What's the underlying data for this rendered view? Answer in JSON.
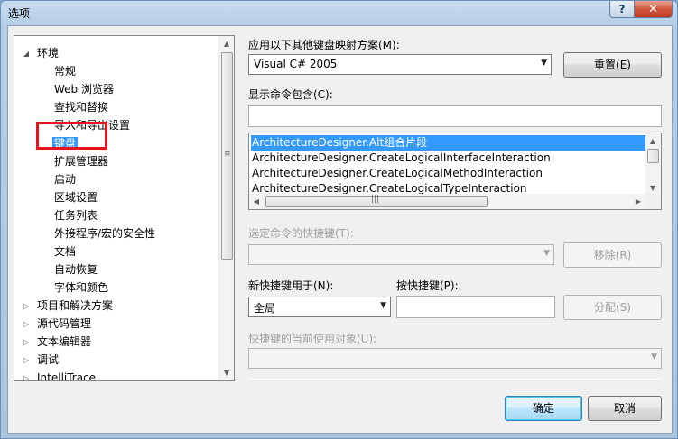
{
  "window": {
    "title": "选项",
    "help_glyph": "?",
    "close_glyph": "✕"
  },
  "tree": {
    "items": [
      {
        "label": "环境",
        "level": 0,
        "expanded": true
      },
      {
        "label": "常规",
        "level": 1
      },
      {
        "label": "Web 浏览器",
        "level": 1
      },
      {
        "label": "查找和替换",
        "level": 1
      },
      {
        "label": "导入和导出设置",
        "level": 1
      },
      {
        "label": "键盘",
        "level": 1,
        "selected": true
      },
      {
        "label": "扩展管理器",
        "level": 1
      },
      {
        "label": "启动",
        "level": 1
      },
      {
        "label": "区域设置",
        "level": 1
      },
      {
        "label": "任务列表",
        "level": 1
      },
      {
        "label": "外接程序/宏的安全性",
        "level": 1
      },
      {
        "label": "文档",
        "level": 1
      },
      {
        "label": "自动恢复",
        "level": 1
      },
      {
        "label": "字体和颜色",
        "level": 1
      },
      {
        "label": "项目和解决方案",
        "level": 0,
        "expanded": false
      },
      {
        "label": "源代码管理",
        "level": 0,
        "expanded": false
      },
      {
        "label": "文本编辑器",
        "level": 0,
        "expanded": false
      },
      {
        "label": "调试",
        "level": 0,
        "expanded": false
      },
      {
        "label": "IntelliTrace",
        "level": 0,
        "expanded": false
      }
    ]
  },
  "keyboard_page": {
    "mapping_scheme_label": "应用以下其他键盘映射方案(M):",
    "mapping_scheme_value": "Visual C# 2005",
    "reset_button": "重置(E)",
    "show_commands_label": "显示命令包含(C):",
    "show_commands_value": "",
    "commands": [
      "ArchitectureDesigner.Alt组合片段",
      "ArchitectureDesigner.CreateLogicalInterfaceInteraction",
      "ArchitectureDesigner.CreateLogicalMethodInteraction",
      "ArchitectureDesigner.CreateLogicalTypeInteraction"
    ],
    "selected_command_index": 0,
    "shortcuts_for_selected_label": "选定命令的快捷键(T):",
    "remove_button": "移除(R)",
    "use_new_shortcut_in_label": "新快捷键用于(N):",
    "use_new_shortcut_in_value": "全局",
    "press_shortcut_keys_label": "按快捷键(P):",
    "press_shortcut_keys_value": "",
    "assign_button": "分配(S)",
    "shortcut_currently_used_by_label": "快捷键的当前使用对象(U):",
    "ok_button": "确定",
    "cancel_button": "取消"
  },
  "colors": {
    "selection": "#3399ff",
    "highlight_box": "#e8141d",
    "close_button": "#c23c22"
  }
}
